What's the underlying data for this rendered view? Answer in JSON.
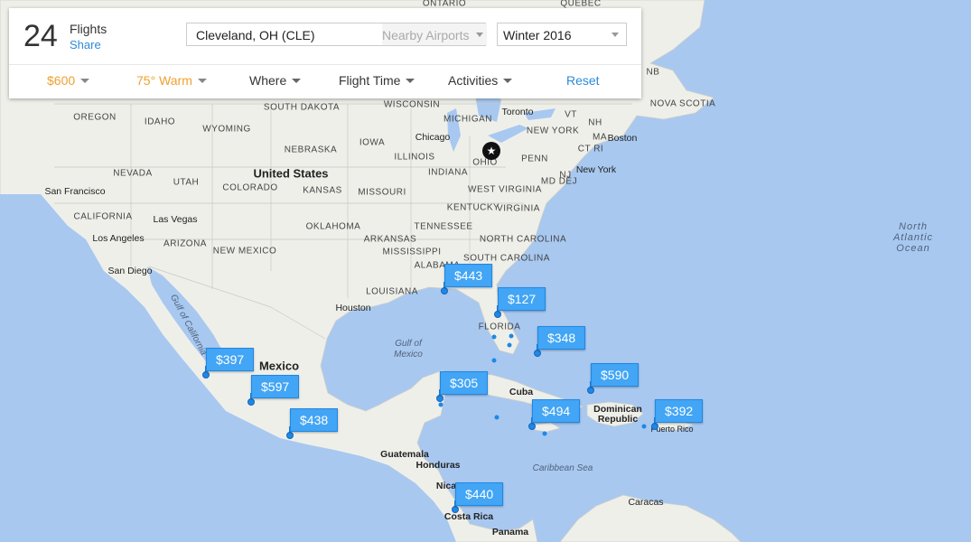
{
  "header": {
    "count": "24",
    "flights_label": "Flights",
    "share_label": "Share",
    "origin_value": "Cleveland, OH (CLE)",
    "nearby_placeholder": "Nearby Airports",
    "season_value": "Winter 2016"
  },
  "filters": {
    "budget": "$600",
    "weather": "75° Warm",
    "where": "Where",
    "flight_time": "Flight Time",
    "activities": "Activities",
    "reset": "Reset"
  },
  "colors": {
    "water": "#a8c8f0",
    "land": "#efefea",
    "marker": "#42a5f5",
    "accent_orange": "#f0a030",
    "link_blue": "#2e8ad8"
  },
  "home_marker": {
    "icon": "star-icon",
    "glyph": "★"
  },
  "prices": {
    "p443": "$443",
    "p127": "$127",
    "p348": "$348",
    "p590": "$590",
    "p305": "$305",
    "p494": "$494",
    "p392": "$392",
    "p397": "$397",
    "p597": "$597",
    "p438": "$438",
    "p440": "$440"
  },
  "map_labels": {
    "ontario": "ONTARIO",
    "quebec": "QUEBEC",
    "nb": "NB",
    "nova_scotia": "NOVA SCOTIA",
    "oregon": "OREGON",
    "idaho": "IDAHO",
    "wyoming": "WYOMING",
    "south_dakota": "SOUTH DAKOTA",
    "nebraska": "NEBRASKA",
    "iowa": "IOWA",
    "illinois": "ILLINOIS",
    "indiana": "INDIANA",
    "ohio": "OHIO",
    "michigan": "MICHIGAN",
    "wisconsin": "WISCONSIN",
    "nevada": "NEVADA",
    "utah": "UTAH",
    "colorado": "COLORADO",
    "kansas": "KANSAS",
    "missouri": "MISSOURI",
    "california": "CALIFORNIA",
    "arizona": "ARIZONA",
    "new_mexico": "NEW MEXICO",
    "oklahoma": "OKLAHOMA",
    "arkansas": "ARKANSAS",
    "tennessee": "TENNESSEE",
    "kentucky": "KENTUCKY",
    "mississippi": "MISSISSIPPI",
    "alabama": "ALABAMA",
    "louisiana": "LOUISIANA",
    "florida": "FLORIDA",
    "west_virginia": "WEST VIRGINIA",
    "virginia": "VIRGINIA",
    "north_carolina": "NORTH CAROLINA",
    "south_carolina": "SOUTH CAROLINA",
    "new_york_state": "NEW YORK",
    "penn": "PENN",
    "nh": "NH",
    "vt": "VT",
    "ma": "MA",
    "ct_ri": "CT RI",
    "md_dej": "MD DEJ",
    "nj": "NJ",
    "toronto": "Toronto",
    "chicago": "Chicago",
    "boston": "Boston",
    "new_york": "New York",
    "san_francisco": "San Francisco",
    "las_vegas": "Las Vegas",
    "los_angeles": "Los Angeles",
    "san_diego": "San Diego",
    "houston": "Houston",
    "caracas": "Caracas",
    "united_states": "United States",
    "mexico": "Mexico",
    "cuba": "Cuba",
    "dominican_republic": "Dominican Republic",
    "puerto_rico": "Puerto Rico",
    "guatemala": "Guatemala",
    "honduras": "Honduras",
    "nicaragua": "Nica",
    "costa_rica": "Costa Rica",
    "panama": "Panama",
    "gulf_of_mexico": "Gulf of Mexico",
    "gulf_of_california": "Gulf of California",
    "caribbean_sea": "Caribbean Sea",
    "north_atlantic_ocean": "North Atlantic Ocean"
  }
}
